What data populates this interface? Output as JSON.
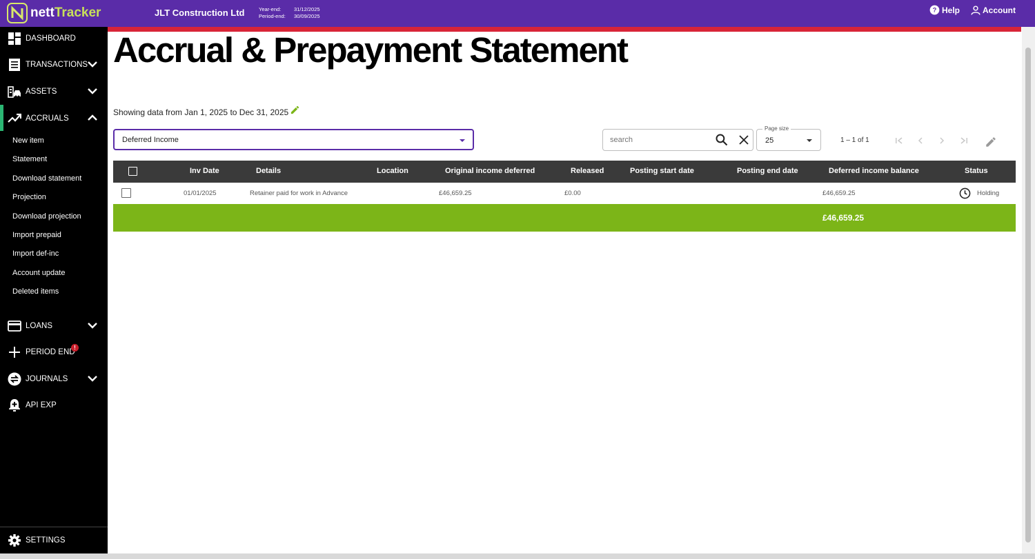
{
  "app": {
    "logo_prefix": "nett",
    "logo_suffix": "Tracker",
    "company": "JLT Construction Ltd",
    "year_end_label": "Year-end:",
    "year_end_value": "31/12/2025",
    "period_end_label": "Period-end:",
    "period_end_value": "30/09/2025",
    "help_label": "Help",
    "account_label": "Account"
  },
  "sidebar": {
    "dashboard": "DASHBOARD",
    "transactions": "TRANSACTIONS",
    "assets": "ASSETS",
    "accruals": "ACCRUALS",
    "accrual_items": [
      "New item",
      "Statement",
      "Download statement",
      "Projection",
      "Download projection",
      "Import prepaid",
      "Import def-inc",
      "Account update",
      "Deleted items"
    ],
    "loans": "LOANS",
    "period_end": "PERIOD END",
    "period_end_badge": "!",
    "journals": "JOURNALS",
    "api_exp": "API EXP",
    "settings": "SETTINGS"
  },
  "page": {
    "title": "Accrual & Prepayment Statement",
    "showing_text": "Showing data from Jan 1, 2025 to Dec 31, 2025",
    "type_select": "Deferred Income",
    "search_placeholder": "search",
    "page_size_label": "Page size",
    "page_size_value": "25",
    "range_text": "1 – 1 of 1"
  },
  "table": {
    "columns": [
      "Inv Date",
      "Details",
      "Location",
      "Original income deferred",
      "Released",
      "Posting start date",
      "Posting end date",
      "Deferred income balance",
      "Status"
    ],
    "rows": [
      {
        "inv_date": "01/01/2025",
        "details": "Retainer paid for work in Advance",
        "location": "",
        "original": "£46,659.25",
        "released": "£0.00",
        "posting_start": "",
        "posting_end": "",
        "balance": "£46,659.25",
        "status": "Holding"
      }
    ],
    "total_balance": "£46,659.25"
  },
  "colors": {
    "topbar": "#5a2ca8",
    "accent_red": "#d82438",
    "total_green": "#7cb518",
    "active_green": "#2bb673",
    "header_dark": "#3a3a3a"
  }
}
